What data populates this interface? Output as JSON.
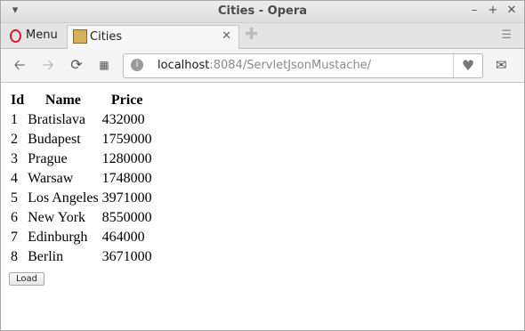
{
  "window": {
    "title": "Cities - Opera"
  },
  "tabs": {
    "menu_label": "Menu",
    "active_tab_label": "Cities"
  },
  "address": {
    "host": "localhost",
    "rest": ":8084/ServletJsonMustache/"
  },
  "table": {
    "headers": [
      "Id",
      "Name",
      "Price"
    ],
    "rows": [
      [
        "1",
        "Bratislava",
        "432000"
      ],
      [
        "2",
        "Budapest",
        "1759000"
      ],
      [
        "3",
        "Prague",
        "1280000"
      ],
      [
        "4",
        "Warsaw",
        "1748000"
      ],
      [
        "5",
        "Los Angeles",
        "3971000"
      ],
      [
        "6",
        "New York",
        "8550000"
      ],
      [
        "7",
        "Edinburgh",
        "464000"
      ],
      [
        "8",
        "Berlin",
        "3671000"
      ]
    ]
  },
  "buttons": {
    "load_label": "Load"
  },
  "icons": {
    "window_menu": "chevron-down-icon",
    "minimize": "minimize-icon",
    "maximize": "maximize-icon",
    "close": "close-icon",
    "back": "back-arrow-icon",
    "forward": "forward-arrow-icon",
    "reload": "reload-icon",
    "speed_dial": "grid-icon",
    "bookmark": "heart-icon",
    "mail": "mail-icon"
  }
}
